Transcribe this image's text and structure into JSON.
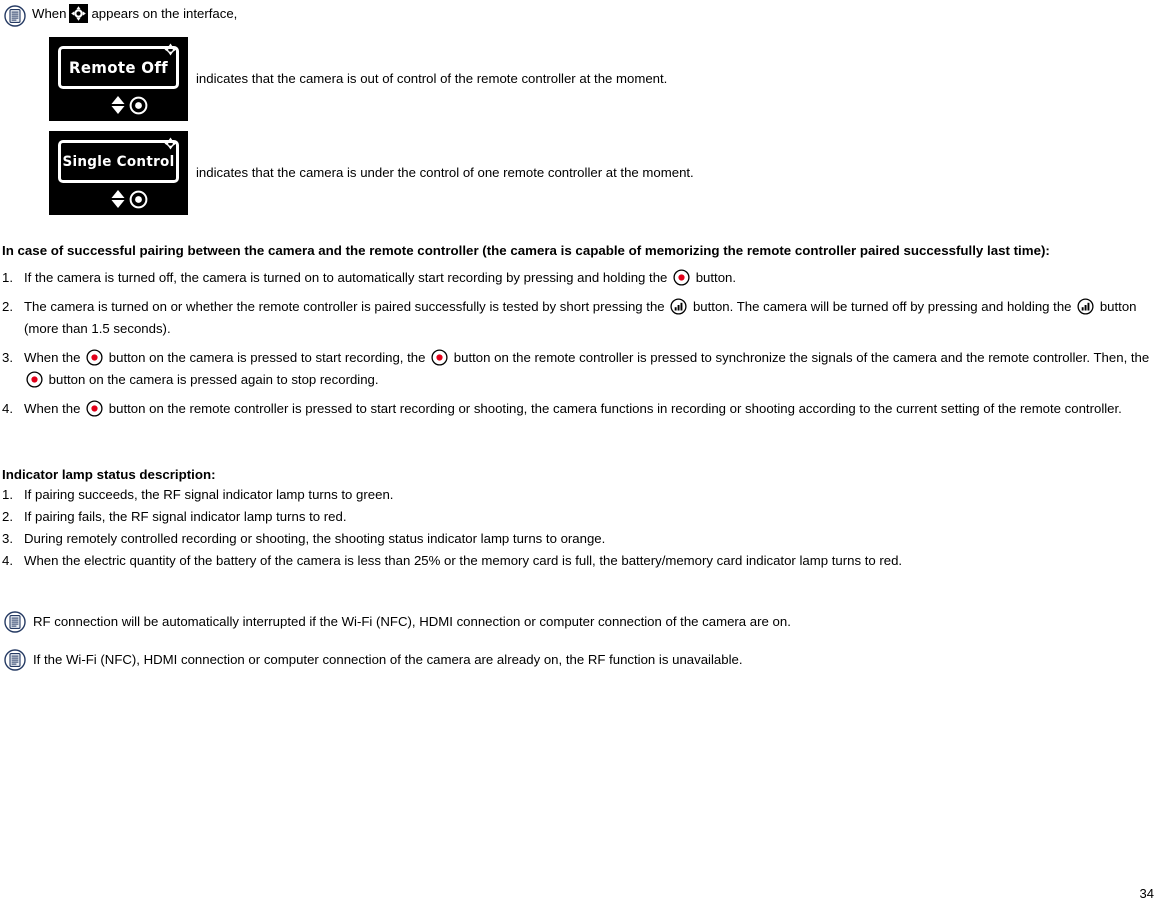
{
  "document": {
    "page_number": "34"
  },
  "top_note": {
    "icon": "note-document-icon",
    "text_before": "When",
    "inline_icon": "crosshair-remote-icon",
    "text_after": "appears on the interface,"
  },
  "screens": [
    {
      "icon": "lcd-screen-icon",
      "display_text": "Remote Off",
      "corner_icon": "crosshair-remote-icon",
      "bottom_icons": [
        "updown-arrow-icon",
        "shutter-ring-icon"
      ],
      "caption": "indicates that the camera is out of control of the remote controller at the moment."
    },
    {
      "icon": "lcd-screen-icon",
      "display_text": "Single Control",
      "corner_icon": "crosshair-remote-icon",
      "bottom_icons": [
        "updown-arrow-icon",
        "shutter-ring-icon"
      ],
      "caption": "indicates that the camera is under the control of one remote controller at the moment."
    }
  ],
  "pairing_section": {
    "heading": "In case of successful pairing between the camera and the remote controller (the camera is capable of memorizing the remote controller paired successfully last time):",
    "items": [
      {
        "marker": "1.",
        "parts": [
          {
            "type": "text",
            "value": "If the camera is turned off, the camera is turned on to automatically start recording by pressing and holding the "
          },
          {
            "type": "icon",
            "value": "record-button-icon"
          },
          {
            "type": "text",
            "value": " button."
          }
        ]
      },
      {
        "marker": "2.",
        "parts": [
          {
            "type": "text",
            "value": "The camera is turned on or whether the remote controller is paired successfully is tested by short pressing the "
          },
          {
            "type": "icon",
            "value": "signal-bars-button-icon"
          },
          {
            "type": "text",
            "value": " button. The camera will be turned off by pressing and holding the "
          },
          {
            "type": "icon",
            "value": "signal-bars-button-icon"
          },
          {
            "type": "text",
            "value": " button (more than 1.5 seconds)."
          }
        ]
      },
      {
        "marker": "3.",
        "parts": [
          {
            "type": "text",
            "value": "When the "
          },
          {
            "type": "icon",
            "value": "record-button-icon"
          },
          {
            "type": "text",
            "value": " button on the camera is pressed to start recording, the "
          },
          {
            "type": "icon",
            "value": "record-button-icon"
          },
          {
            "type": "text",
            "value": " button on the remote controller is pressed to synchronize the signals of the camera and the remote controller. Then, the "
          },
          {
            "type": "icon",
            "value": "record-button-icon"
          },
          {
            "type": "text",
            "value": " button on the camera is pressed again to stop recording."
          }
        ]
      },
      {
        "marker": "4.",
        "parts": [
          {
            "type": "text",
            "value": "When the "
          },
          {
            "type": "icon",
            "value": "record-button-icon"
          },
          {
            "type": "text",
            "value": " button on the remote controller is pressed to start recording or shooting, the camera functions in recording or shooting according to the current setting of the remote controller."
          }
        ]
      }
    ]
  },
  "indicator_section": {
    "heading": "Indicator lamp status description:",
    "items": [
      {
        "marker": "1.",
        "text": "If pairing succeeds, the RF signal indicator lamp turns to green."
      },
      {
        "marker": "2.",
        "text": "If pairing fails, the RF signal indicator lamp turns to red."
      },
      {
        "marker": "3.",
        "text": "During remotely controlled recording or shooting, the shooting status indicator lamp turns to orange."
      },
      {
        "marker": "4.",
        "text": "When the electric quantity of the battery of the camera is less than 25% or the memory card is full, the battery/memory card indicator lamp turns to red."
      }
    ]
  },
  "bottom_notes": [
    {
      "icon": "note-document-icon",
      "text": "RF connection will be automatically interrupted if the Wi-Fi (NFC), HDMI connection or computer connection of the camera are on."
    },
    {
      "icon": "note-document-icon",
      "text": "If the Wi-Fi (NFC), HDMI connection or computer connection of the camera are already on, the RF function is unavailable."
    }
  ],
  "colors": {
    "record_dot": "#e2001a",
    "note_icon_outline": "#253a63",
    "lcd_background": "#000000",
    "lcd_foreground": "#ffffff",
    "text": "#000000"
  }
}
